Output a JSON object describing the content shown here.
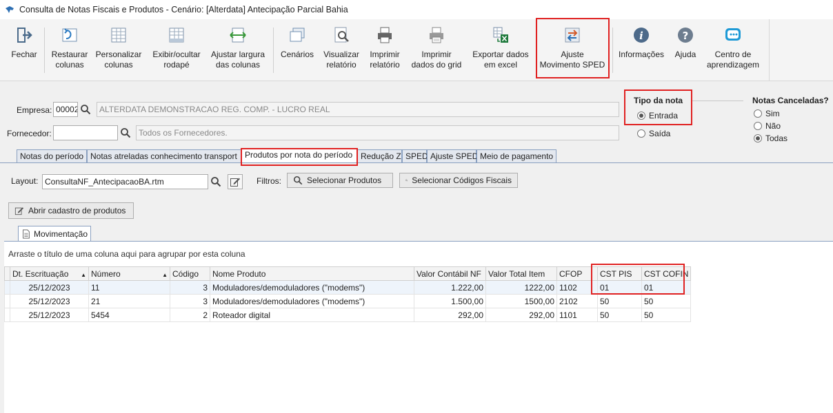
{
  "window": {
    "title": "Consulta de Notas Fiscais e Produtos - Cenário: [Alterdata] Antecipação Parcial Bahia"
  },
  "toolbar": {
    "buttons": [
      {
        "id": "fechar",
        "l1": "Fechar",
        "l2": ""
      },
      {
        "id": "restaurar",
        "l1": "Restaurar",
        "l2": "colunas"
      },
      {
        "id": "personalizar",
        "l1": "Personalizar",
        "l2": "colunas"
      },
      {
        "id": "exibir",
        "l1": "Exibir/ocultar",
        "l2": "rodapé"
      },
      {
        "id": "ajustar",
        "l1": "Ajustar largura",
        "l2": "das colunas"
      },
      {
        "id": "cenarios",
        "l1": "Cenários",
        "l2": ""
      },
      {
        "id": "visualizar",
        "l1": "Visualizar",
        "l2": "relatório"
      },
      {
        "id": "imprimir-rel",
        "l1": "Imprimir",
        "l2": "relatório"
      },
      {
        "id": "imprimir-grid",
        "l1": "Imprimir",
        "l2": "dados do grid"
      },
      {
        "id": "exportar",
        "l1": "Exportar dados",
        "l2": "em excel"
      },
      {
        "id": "ajuste-sped",
        "l1": "Ajuste",
        "l2": "Movimento SPED"
      },
      {
        "id": "informacoes",
        "l1": "Informações",
        "l2": ""
      },
      {
        "id": "ajuda",
        "l1": "Ajuda",
        "l2": ""
      },
      {
        "id": "centro",
        "l1": "Centro de",
        "l2": "aprendizagem"
      }
    ]
  },
  "filters": {
    "empresa_label": "Empresa:",
    "empresa_code": "00002",
    "empresa_name": "ALTERDATA DEMONSTRACAO REG. COMP. - LUCRO REAL",
    "fornecedor_label": "Fornecedor:",
    "fornecedor_code": "",
    "fornecedor_name": "Todos os Fornecedores."
  },
  "tipo_nota": {
    "title": "Tipo da nota",
    "entrada": "Entrada",
    "saida": "Saída",
    "selected": "entrada"
  },
  "canceladas": {
    "title": "Notas Canceladas?",
    "sim": "Sim",
    "nao": "Não",
    "todas": "Todas",
    "selected": "todas"
  },
  "tabs": [
    "Notas do período",
    "Notas atreladas conhecimento transport",
    "Produtos por nota do período",
    "Redução Z",
    "SPED",
    "Ajuste SPED",
    "Meio de pagamento"
  ],
  "active_tab": "Produtos por nota do período",
  "layout": {
    "label": "Layout:",
    "value": "ConsultaNF_AntecipacaoBA.rtm"
  },
  "filtros": {
    "label": "Filtros:",
    "produtos_btn": "Selecionar Produtos",
    "codigos_btn": "Selecionar Códigos Fiscais"
  },
  "abrir_btn": "Abrir cadastro de produtos",
  "subtab": "Movimentação",
  "group_hint": "Arraste o título de uma coluna aqui para agrupar por esta coluna",
  "grid": {
    "columns": [
      "Dt. Escrituação",
      "Número",
      "Código",
      "Nome Produto",
      "Valor Contábil NF",
      "Valor Total Item",
      "CFOP",
      "CST PIS",
      "CST COFIN"
    ],
    "rows": [
      [
        "25/12/2023",
        "11",
        "3",
        "Moduladores/demoduladores (\"modems\")",
        "1.222,00",
        "1222,00",
        "1102",
        "01",
        "01"
      ],
      [
        "25/12/2023",
        "21",
        "3",
        "Moduladores/demoduladores (\"modems\")",
        "1.500,00",
        "1500,00",
        "2102",
        "50",
        "50"
      ],
      [
        "25/12/2023",
        "5454",
        "2",
        "Roteador digital",
        "292,00",
        "292,00",
        "1101",
        "50",
        "50"
      ]
    ]
  }
}
